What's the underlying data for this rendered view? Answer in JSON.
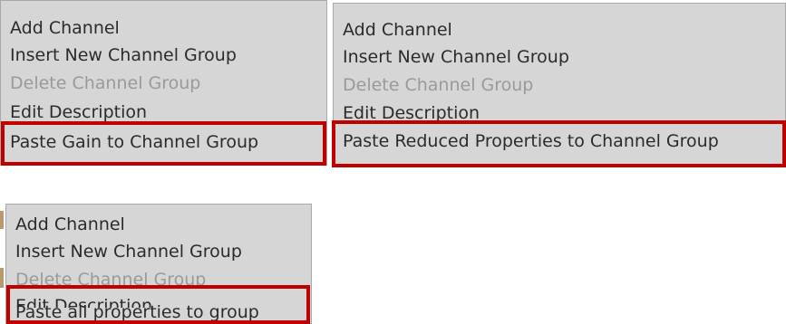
{
  "menus": [
    {
      "items": [
        {
          "label": "Add Channel",
          "enabled": true
        },
        {
          "label": "Insert New Channel Group",
          "enabled": true
        },
        {
          "label": "Delete Channel Group",
          "enabled": false
        },
        {
          "label": "Edit Description",
          "enabled": true
        },
        {
          "label": "Paste Gain to Channel Group",
          "enabled": true,
          "highlighted": true
        }
      ]
    },
    {
      "items": [
        {
          "label": "Add Channel",
          "enabled": true
        },
        {
          "label": "Insert New Channel Group",
          "enabled": true
        },
        {
          "label": "Delete Channel Group",
          "enabled": false
        },
        {
          "label": "Edit Description",
          "enabled": true
        },
        {
          "label": "Paste Reduced Properties to Channel Group",
          "enabled": true,
          "highlighted": true
        }
      ]
    },
    {
      "items": [
        {
          "label": "Add Channel",
          "enabled": true
        },
        {
          "label": "Insert New Channel Group",
          "enabled": true
        },
        {
          "label": "Delete Channel Group",
          "enabled": false
        },
        {
          "label": "Edit Description",
          "enabled": true
        },
        {
          "label": "Paste all properties to group",
          "enabled": true,
          "highlighted": true
        }
      ]
    }
  ],
  "colors": {
    "menu_background": "#d6d6d6",
    "text": "#2b2b2b",
    "disabled_text": "#9a9a9a",
    "highlight_border": "#c00000"
  }
}
